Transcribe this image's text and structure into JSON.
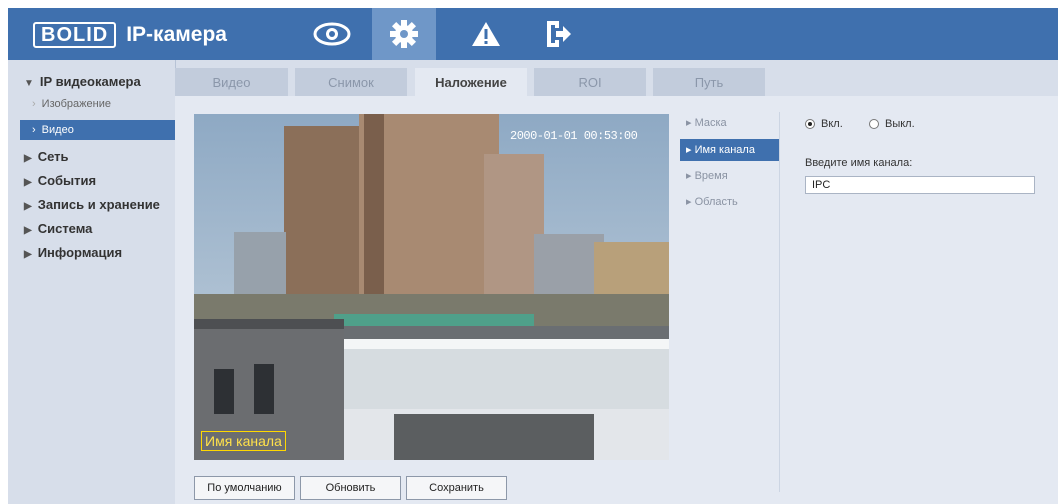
{
  "header": {
    "logo": "BOLID",
    "title": "IP-камера",
    "icons": [
      "eye-icon",
      "gear-icon",
      "warning-icon",
      "logout-icon"
    ]
  },
  "sidebar": {
    "ip_camera": "IP видеокамера",
    "image": "Изображение",
    "video": "Видео",
    "network": "Сеть",
    "events": "События",
    "storage": "Запись и хранение",
    "system": "Система",
    "info": "Информация"
  },
  "tabs": [
    "Видео",
    "Снимок",
    "Наложение",
    "ROI",
    "Путь"
  ],
  "video": {
    "timestamp": "2000-01-01 00:53:00",
    "channel_osd": "Имя канала"
  },
  "submenu": [
    "Маска",
    "Имя канала",
    "Время",
    "Область"
  ],
  "settings": {
    "on_label": "Вкл.",
    "off_label": "Выкл.",
    "field_label": "Введите имя канала:",
    "field_value": "IPC"
  },
  "buttons": {
    "default": "По умолчанию",
    "refresh": "Обновить",
    "save": "Сохранить"
  },
  "colors": {
    "header_bg": "#3f70ae",
    "active_bg": "#3f70ae",
    "panel_bg": "#e4e9f2",
    "sidebar_bg": "#d7deea"
  }
}
